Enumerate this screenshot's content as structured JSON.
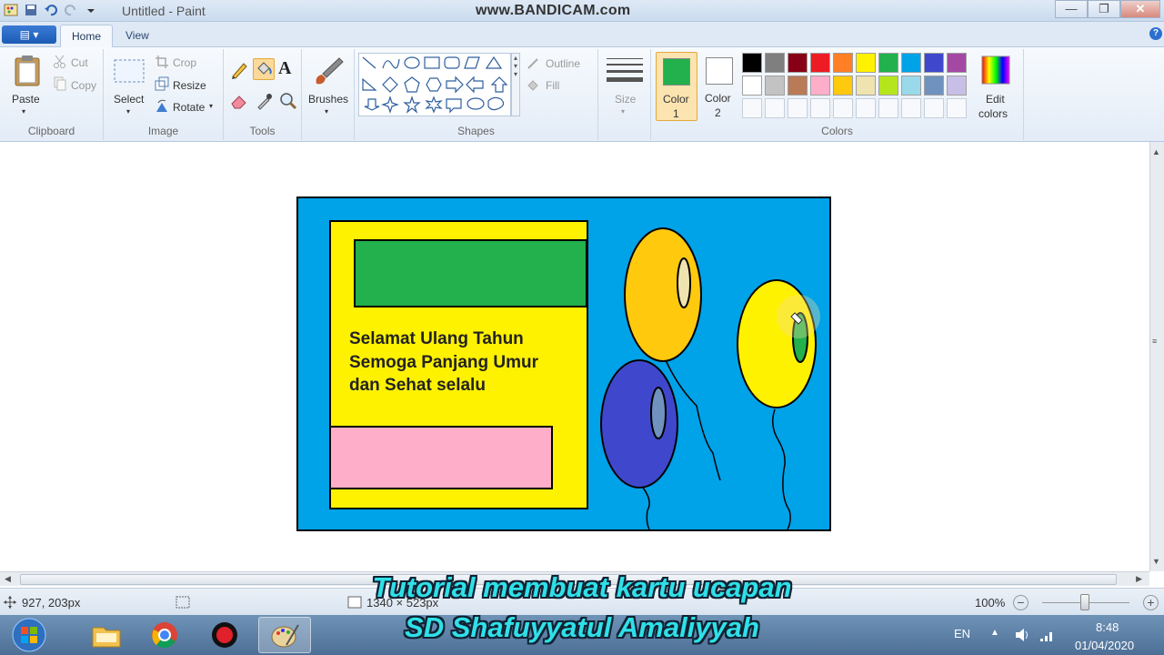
{
  "window": {
    "title": "Untitled - Paint",
    "watermark": "www.BANDICAM.com",
    "buttons": {
      "minimize": "—",
      "maximize": "❐",
      "close": "✕"
    }
  },
  "ribbon": {
    "file_menu": "▤ ▾",
    "tabs": [
      {
        "label": "Home",
        "active": true
      },
      {
        "label": "View",
        "active": false
      }
    ],
    "help": "?",
    "clipboard": {
      "paste": "Paste",
      "cut": "Cut",
      "copy": "Copy",
      "group": "Clipboard"
    },
    "image": {
      "select": "Select",
      "crop": "Crop",
      "resize": "Resize",
      "rotate": "Rotate",
      "group": "Image"
    },
    "tools": {
      "group": "Tools",
      "text_tool": "A"
    },
    "brushes": {
      "label": "Brushes"
    },
    "shapes": {
      "outline": "Outline",
      "fill": "Fill",
      "group": "Shapes"
    },
    "size": {
      "label": "Size"
    },
    "color1": {
      "label": "Color",
      "sub": "1",
      "value": "#22b14c"
    },
    "color2": {
      "label": "Color",
      "sub": "2",
      "value": "#ffffff"
    },
    "edit_colors": {
      "line1": "Edit",
      "line2": "colors"
    },
    "colors_group": "Colors",
    "palette_row1": [
      "#000000",
      "#7f7f7f",
      "#880015",
      "#ed1c24",
      "#ff7f27",
      "#fff200",
      "#22b14c",
      "#00a2e8",
      "#3f48cc",
      "#a349a4"
    ],
    "palette_row2": [
      "#ffffff",
      "#c3c3c3",
      "#b97a57",
      "#ffaec9",
      "#ffc90e",
      "#efe4b0",
      "#b5e61d",
      "#99d9ea",
      "#7092be",
      "#c8bfe7"
    ]
  },
  "card": {
    "greeting_line1": "Selamat Ulang Tahun",
    "greeting_line2": "Semoga Panjang Umur",
    "greeting_line3": "dan Sehat selalu",
    "colors": {
      "background": "#00a2e8",
      "panel": "#fff200",
      "banner": "#22b14c",
      "pink_box": "#ffaec9",
      "balloon_orange": "#ffc90e",
      "balloon_yellow": "#fff200",
      "balloon_blue": "#3f48cc"
    }
  },
  "status": {
    "cursor_pos": "927, 203px",
    "canvas_size": "1340 × 523px",
    "zoom": "100%"
  },
  "caption": {
    "line1": "Tutorial membuat kartu ucapan",
    "line2": "SD Shafuyyatul Amaliyyah"
  },
  "taskbar": {
    "lang": "EN",
    "time": "8:48",
    "date": "01/04/2020"
  }
}
